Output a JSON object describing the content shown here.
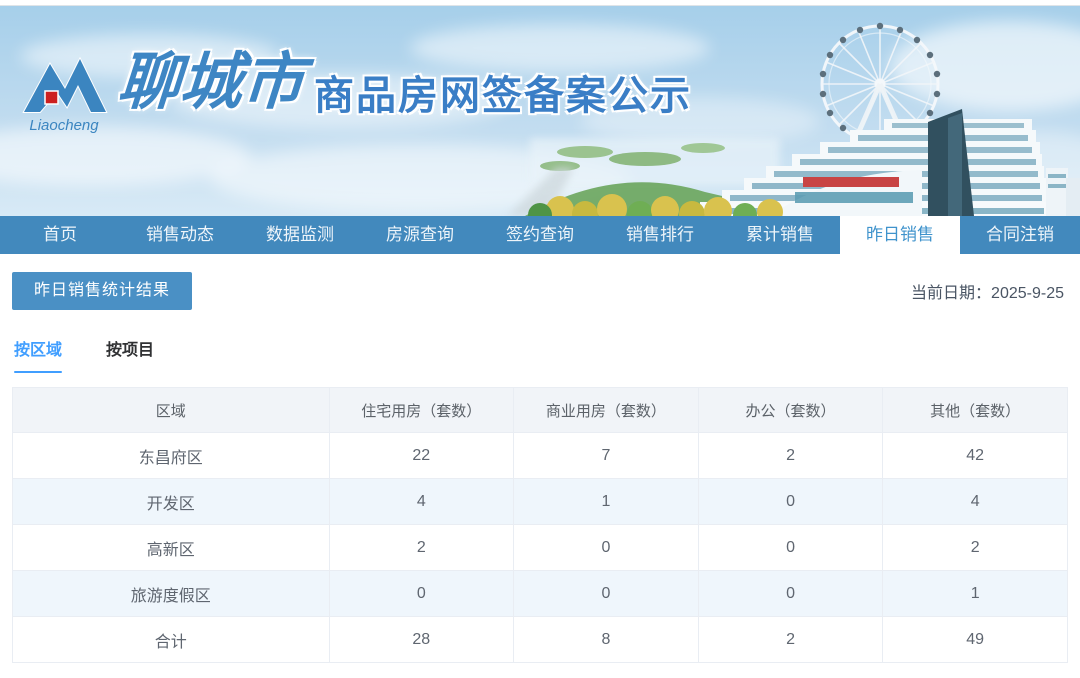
{
  "banner": {
    "logo_script": "Liaocheng",
    "city_name": "聊城市",
    "title": "商品房网签备案公示"
  },
  "nav": {
    "items": [
      {
        "label": "首页",
        "active": false
      },
      {
        "label": "销售动态",
        "active": false
      },
      {
        "label": "数据监测",
        "active": false
      },
      {
        "label": "房源查询",
        "active": false
      },
      {
        "label": "签约查询",
        "active": false
      },
      {
        "label": "销售排行",
        "active": false
      },
      {
        "label": "累计销售",
        "active": false
      },
      {
        "label": "昨日销售",
        "active": true
      },
      {
        "label": "合同注销",
        "active": false
      }
    ]
  },
  "toolbar": {
    "section_button": "昨日销售统计结果",
    "date_label": "当前日期：",
    "date_value": "2025-9-25"
  },
  "tabs": [
    {
      "label": "按区域",
      "active": true
    },
    {
      "label": "按项目",
      "active": false
    }
  ],
  "table": {
    "headers": [
      "区域",
      "住宅用房（套数）",
      "商业用房（套数）",
      "办公（套数）",
      "其他（套数）"
    ],
    "rows": [
      [
        "东昌府区",
        "22",
        "7",
        "2",
        "42"
      ],
      [
        "开发区",
        "4",
        "1",
        "0",
        "4"
      ],
      [
        "高新区",
        "2",
        "0",
        "0",
        "2"
      ],
      [
        "旅游度假区",
        "0",
        "0",
        "0",
        "1"
      ],
      [
        "合计",
        "28",
        "8",
        "2",
        "49"
      ]
    ]
  },
  "colors": {
    "nav_background": "#4289bd",
    "nav_active_text": "#3f93cc",
    "button_background": "#4a90c5",
    "tab_active_blue": "#409eff",
    "banner_title_blue": "#3a7ec6",
    "logo_red": "#cc2020",
    "table_header_background": "#f1f4f8",
    "table_stripe_background": "#eff6fc",
    "table_border": "#e9edf3",
    "body_text": "#5f6670"
  }
}
